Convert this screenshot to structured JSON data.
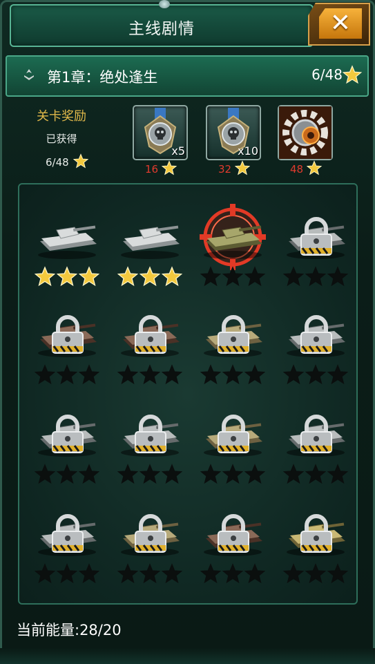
{
  "header": {
    "title": "主线剧情",
    "close_label": "✕"
  },
  "chapter": {
    "title": "第1章：绝处逢生",
    "progress": "6/48"
  },
  "rewards": {
    "label": "关卡奖励",
    "status": "已获得",
    "count": "6/48",
    "items": [
      {
        "icon": "skull-medal-icon",
        "multiplier": "x5",
        "required": "16"
      },
      {
        "icon": "skull-medal-icon",
        "multiplier": "x10",
        "required": "32"
      },
      {
        "icon": "gear-part-icon",
        "multiplier": "",
        "required": "48"
      }
    ]
  },
  "stages": [
    {
      "state": "cleared",
      "stars": 3,
      "tank": "light-tank"
    },
    {
      "state": "cleared",
      "stars": 3,
      "tank": "light-tank"
    },
    {
      "state": "current",
      "stars": 0,
      "tank": "camo-tank"
    },
    {
      "state": "locked",
      "stars": 0,
      "tank": "grey-tank"
    },
    {
      "state": "locked",
      "stars": 0,
      "tank": "brown-tank"
    },
    {
      "state": "locked",
      "stars": 0,
      "tank": "brown-tank"
    },
    {
      "state": "locked",
      "stars": 0,
      "tank": "tan-tank"
    },
    {
      "state": "locked",
      "stars": 0,
      "tank": "grey-tank"
    },
    {
      "state": "locked",
      "stars": 0,
      "tank": "grey-tank"
    },
    {
      "state": "locked",
      "stars": 0,
      "tank": "grey-tank"
    },
    {
      "state": "locked",
      "stars": 0,
      "tank": "tan-tank"
    },
    {
      "state": "locked",
      "stars": 0,
      "tank": "grey-tank"
    },
    {
      "state": "locked",
      "stars": 0,
      "tank": "grey-tank"
    },
    {
      "state": "locked",
      "stars": 0,
      "tank": "tan-tank"
    },
    {
      "state": "locked",
      "stars": 0,
      "tank": "brown-tank"
    },
    {
      "state": "locked",
      "stars": 0,
      "tank": "yellow-tank"
    }
  ],
  "footer": {
    "energy": "当前能量:28/20"
  },
  "colors": {
    "accent_gold": "#e0b84a",
    "required_red": "#e03b2e",
    "panel_green": "#1c6b51",
    "close_orange": "#f7b23b"
  }
}
